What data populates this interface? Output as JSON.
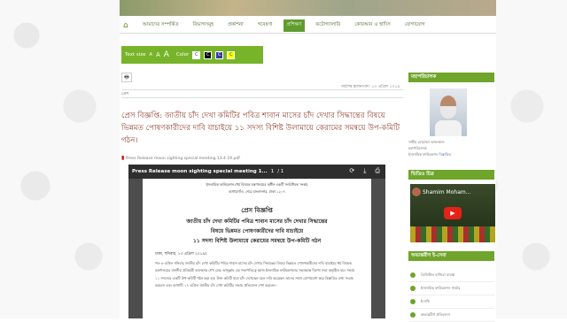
{
  "nav": {
    "home_icon": "home-icon",
    "items": [
      "আমাদের সম্পর্কিত",
      "বিভাগসমূহ",
      "প্রকাশনা",
      "গবেষণা",
      "প্রশিক্ষণ",
      "ফটোগ্যালারি",
      "কোরআন ও হাদিস",
      "যোগাযোগ"
    ],
    "active_index": 4
  },
  "toolbar": {
    "text_size_label": "Text size",
    "sizes": [
      "A",
      "A",
      "A"
    ],
    "color_label": "Color",
    "swatches": [
      "C",
      "C",
      "C",
      "C"
    ],
    "swatch_colors": [
      "#ffffff",
      "#000000",
      "#3a3aa0",
      "#ffff00"
    ]
  },
  "article": {
    "print_icon": "print-icon",
    "date": "সর্বশেষ হালনাগাদ: ১৩ এপ্রিল ২০১৯",
    "category": "প্রেস",
    "headline": "প্রেস বিজ্ঞপ্তি: জাতীয় চাঁদ দেখা কমিটির পবিত্র শাবান মাসের চাঁদ দেখার সিদ্ধান্তের বিষয়ে ভিন্নমত পোষণকারীদের দাবি যাচাইয়ে ১১ সদস্য বিশিষ্ট উলামায়ে কেরামের সমন্বয়ে উপ-কমিটি গঠন।",
    "pdf_link": "Press Release moon sighting special meeting 13.4.19.pdf"
  },
  "viewer": {
    "title": "Press Release moon sighting special meeting 1...",
    "page": "1",
    "page_total": "/ 1",
    "icons": [
      "refresh-icon",
      "download-icon",
      "print-icon"
    ],
    "doc": {
      "lh1": "ইসলামিক ফাউন্ডেশন (ধর্ম বিষয়ক মন্ত্রণালয়ের অধীন একটি সংবিধিবদ্ধ সংস্থা)",
      "lh2": "আগারগাঁও, শেরে বাংলানগর, ঢাকা ১২০৭",
      "title": "প্রেস বিজ্ঞপ্তি",
      "l1": "জাতীয় চাঁদ দেখা কমিটির পবিত্র শাবান মাসের চাঁদ দেখার সিদ্ধান্তের",
      "l2": "বিষয়ে ভিন্নমত পোষণকারীদের দাবি যাচাইয়ে",
      "l3": "১১ সদস্য বিশিষ্ট উলামায়ে কেরামের সমন্বয়ে উপ-কমিটি গঠন",
      "dateline": "ঢাকা, শনিবার, ১৩ এপ্রিল ২০১৯ঃ",
      "body": "গত ৬ এপ্রিল শনিবার জাতীয় চাঁদ দেখা কমিটির পবিত্র শাবান মাসের চাঁদ দেখার সিদ্ধান্তের বিষয়ে ভিন্নমত পোষণকারীদের দাবি যাচাইয়ে ধর্ম বিষয়ক মন্ত্রণালয়ের মাননীয় প্রতিমন্ত্রী আলহাজ্ব শেখ মোঃ আব্দুল্লাহ এর সভাপতিত্বে আজ ইসলামিক ফাউন্ডেশনের সভাকক্ষে বিশেষ সভা অনুষ্ঠিত হয়। সভায় ১১ সদস্যের একটি উপ-কমিটি গঠন করা হয়। উক্ত কমিটি যারা চাঁদ দেখেছেন বলে দাবি করেছেন তাদের সাথে যোগাযোগ করে বিস্তারিত তথ্য সংগ্রহ করবেন এবং আগামী ১৭ এপ্রিল জাতীয় চাঁদ দেখা কমিটির সভায় প্রতিবেদন পেশ করবেন।"
    }
  },
  "sidebar": {
    "dg_header": "মহাপরিচালক",
    "dg_name": "সামীম মোহাম্মদ আফজাল",
    "dg_title": "মহাপরিচালক",
    "dg_org": "ইসলামিক ফাউন্ডেশন",
    "dg_more": "বিস্তারিত",
    "video_header": "ভিডিও চিত্র",
    "video_title": "Shamim Moham...",
    "video_play_icon": "play-icon",
    "links_header": "অভ্যন্তরীণ ই-সেবা",
    "links": [
      "ডিজিটাল হাজিরা ব্যবস্থা",
      "ইসলামিক ফাউন্ডেশন সার্ভার",
      "ই-নথি",
      "অভ্যন্তরীণ প্রতিবেদন"
    ]
  }
}
